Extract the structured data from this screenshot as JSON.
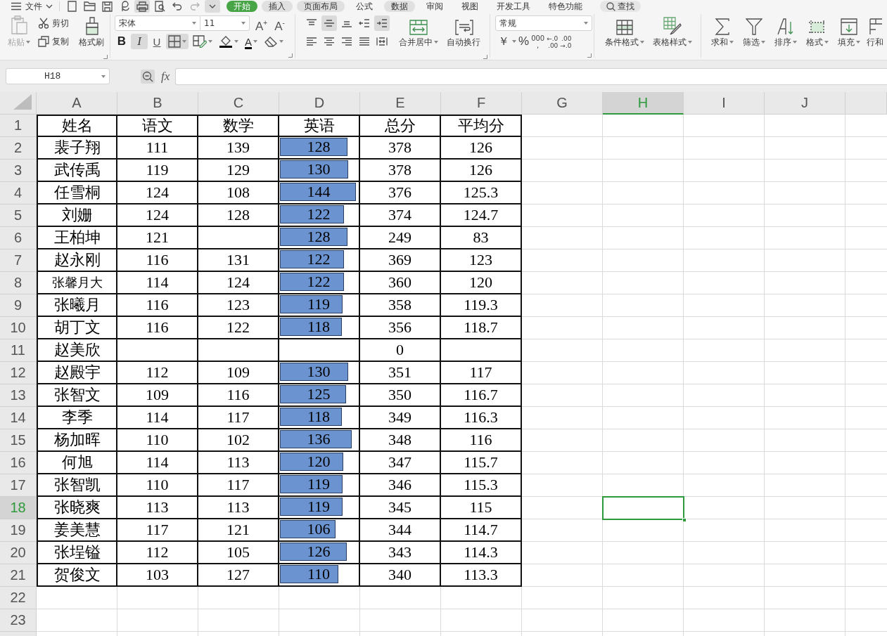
{
  "menu_bar": {
    "file_menu": "文件",
    "quick_access": [
      {
        "kind": "new",
        "shaded": false,
        "disabled": false
      },
      {
        "kind": "open",
        "shaded": false,
        "disabled": false
      },
      {
        "kind": "save",
        "shaded": false,
        "disabled": false
      },
      {
        "kind": "export",
        "shaded": false,
        "disabled": false
      },
      {
        "kind": "print",
        "shaded": true,
        "disabled": false
      },
      {
        "kind": "preview",
        "shaded": false,
        "disabled": false
      },
      {
        "kind": "undo",
        "shaded": false,
        "disabled": false
      },
      {
        "kind": "redo",
        "shaded": false,
        "disabled": true
      },
      {
        "kind": "more",
        "shaded": true,
        "disabled": false
      }
    ],
    "tabs": [
      {
        "label": "开始",
        "selected": true,
        "shaded": false
      },
      {
        "label": "插入",
        "selected": false,
        "shaded": true
      },
      {
        "label": "页面布局",
        "selected": false,
        "shaded": true
      },
      {
        "label": "公式",
        "selected": false,
        "shaded": false
      },
      {
        "label": "数据",
        "selected": false,
        "shaded": true
      },
      {
        "label": "审阅",
        "selected": false,
        "shaded": false
      },
      {
        "label": "视图",
        "selected": false,
        "shaded": false
      },
      {
        "label": "开发工具",
        "selected": false,
        "shaded": false
      },
      {
        "label": "特色功能",
        "selected": false,
        "shaded": false
      }
    ],
    "search": "查找"
  },
  "ribbon": {
    "clipboard": {
      "launcher": true,
      "buttons": [
        {
          "kind": "paste",
          "label": "粘贴",
          "disabled": true,
          "dropdown": true
        },
        {
          "kind": "cut",
          "label": "剪切",
          "disabled": false,
          "dropdown": false
        },
        {
          "kind": "copy",
          "label": "复制",
          "disabled": false,
          "dropdown": false
        },
        {
          "kind": "format-painter",
          "label": "格式刷",
          "disabled": false,
          "dropdown": false
        }
      ]
    },
    "font": {
      "launcher": true,
      "name": "宋体",
      "size": "11",
      "grow": "A$^{+}$",
      "shrink": "A$^{-}$",
      "buttons": [
        {
          "kind": "bold",
          "label": "B",
          "selected": false,
          "dropdown": false
        },
        {
          "kind": "italic",
          "label": "I",
          "selected": true,
          "dropdown": false
        },
        {
          "kind": "underline",
          "label": "U",
          "selected": false,
          "dropdown": false
        },
        {
          "kind": "borders",
          "selected": true,
          "dropdown": true
        },
        {
          "kind": "draw-borders",
          "selected": false,
          "dropdown": true
        },
        {
          "kind": "fill-color",
          "selected": false,
          "dropdown": true
        },
        {
          "kind": "font-color",
          "label": "A",
          "selected": false,
          "dropdown": true
        },
        {
          "kind": "clear",
          "selected": false,
          "dropdown": true
        }
      ]
    },
    "alignment": {
      "launcher": true,
      "buttons": [
        {
          "kind": "top",
          "selected": false
        },
        {
          "kind": "middle",
          "selected": true
        },
        {
          "kind": "bottom",
          "selected": false
        },
        {
          "kind": "indent-decrease",
          "selected": false
        },
        {
          "kind": "indent-increase",
          "selected": true
        },
        {
          "kind": "left",
          "selected": false
        },
        {
          "kind": "center",
          "selected": false
        },
        {
          "kind": "right",
          "selected": false
        },
        {
          "kind": "justify",
          "selected": false
        },
        {
          "kind": "distributed",
          "selected": false
        }
      ],
      "actions": [
        {
          "kind": "merge",
          "label": "合并居中",
          "dropdown": true
        },
        {
          "kind": "wrap",
          "label": "自动换行",
          "dropdown": false
        }
      ]
    },
    "number": {
      "launcher": true,
      "format": "常规",
      "buttons": [
        {
          "kind": "currency",
          "label": "￥",
          "dropdown": true
        },
        {
          "kind": "percent",
          "label": "%",
          "dropdown": false
        },
        {
          "kind": "thousands",
          "label": "000",
          "sublabel": ",",
          "dropdown": false
        },
        {
          "kind": "increase-decimal",
          "label": "←.0",
          "sublabel": ".00",
          "dropdown": false
        },
        {
          "kind": "decrease-decimal",
          "label": ".00",
          "sublabel": "→.0",
          "dropdown": false
        }
      ]
    },
    "styles": {
      "buttons": [
        {
          "kind": "conditional-format",
          "label": "条件格式",
          "dropdown": true
        },
        {
          "kind": "table-style",
          "label": "表格样式",
          "dropdown": true
        }
      ]
    },
    "editing": {
      "buttons": [
        {
          "kind": "sum",
          "label": "求和",
          "dropdown": true
        },
        {
          "kind": "filter",
          "label": "筛选",
          "dropdown": true
        },
        {
          "kind": "sort",
          "label": "排序",
          "dropdown": true
        },
        {
          "kind": "format",
          "label": "格式",
          "dropdown": true
        },
        {
          "kind": "fill",
          "label": "填充",
          "dropdown": true
        },
        {
          "kind": "rows-columns",
          "label": "行和",
          "dropdown": false
        }
      ]
    }
  },
  "formula_bar": {
    "cell_reference": "H18",
    "function_label": "fx"
  },
  "sheet": {
    "columns": [
      {
        "label": "A",
        "selected": false
      },
      {
        "label": "B",
        "selected": false
      },
      {
        "label": "C",
        "selected": false
      },
      {
        "label": "D",
        "selected": false
      },
      {
        "label": "E",
        "selected": false
      },
      {
        "label": "F",
        "selected": false
      },
      {
        "label": "G",
        "selected": false
      },
      {
        "label": "H",
        "selected": true
      },
      {
        "label": "I",
        "selected": false
      },
      {
        "label": "J",
        "selected": false
      }
    ],
    "row_headers": [
      {
        "label": "1",
        "selected": false
      },
      {
        "label": "2",
        "selected": false
      },
      {
        "label": "3",
        "selected": false
      },
      {
        "label": "4",
        "selected": false
      },
      {
        "label": "5",
        "selected": false
      },
      {
        "label": "6",
        "selected": false
      },
      {
        "label": "7",
        "selected": false
      },
      {
        "label": "8",
        "selected": false
      },
      {
        "label": "9",
        "selected": false
      },
      {
        "label": "10",
        "selected": false
      },
      {
        "label": "11",
        "selected": false
      },
      {
        "label": "12",
        "selected": false
      },
      {
        "label": "13",
        "selected": false
      },
      {
        "label": "14",
        "selected": false
      },
      {
        "label": "15",
        "selected": false
      },
      {
        "label": "16",
        "selected": false
      },
      {
        "label": "17",
        "selected": false
      },
      {
        "label": "18",
        "selected": true
      },
      {
        "label": "19",
        "selected": false
      },
      {
        "label": "20",
        "selected": false
      },
      {
        "label": "21",
        "selected": false
      },
      {
        "label": "22",
        "selected": false
      },
      {
        "label": "23",
        "selected": false
      }
    ],
    "table": {
      "header": [
        "姓名",
        "语文",
        "数学",
        "英语",
        "总分",
        "平均分"
      ],
      "rows": [
        {
          "name": "裴子翔",
          "small_name": false,
          "chinese": "111",
          "math": "139",
          "english": {
            "value": "128",
            "level": 0.87
          },
          "total": "378",
          "average": "126"
        },
        {
          "name": "武传禹",
          "small_name": false,
          "chinese": "119",
          "math": "129",
          "english": {
            "value": "130",
            "level": 0.88
          },
          "total": "378",
          "average": "126"
        },
        {
          "name": "任雪桐",
          "small_name": false,
          "chinese": "124",
          "math": "108",
          "english": {
            "value": "144",
            "level": 0.98
          },
          "total": "376",
          "average": "125.3"
        },
        {
          "name": "刘姗",
          "small_name": false,
          "chinese": "124",
          "math": "128",
          "english": {
            "value": "122",
            "level": 0.83
          },
          "total": "374",
          "average": "124.7"
        },
        {
          "name": "王柏坤",
          "small_name": false,
          "chinese": "121",
          "english": {
            "value": "128",
            "level": 0.87
          },
          "total": "249",
          "average": "83"
        },
        {
          "name": "赵永刚",
          "small_name": false,
          "chinese": "116",
          "math": "131",
          "english": {
            "value": "122",
            "level": 0.83
          },
          "total": "369",
          "average": "123"
        },
        {
          "name": "张馨月大",
          "small_name": true,
          "chinese": "114",
          "math": "124",
          "english": {
            "value": "122",
            "level": 0.83
          },
          "total": "360",
          "average": "120"
        },
        {
          "name": "张曦月",
          "small_name": false,
          "chinese": "116",
          "math": "123",
          "english": {
            "value": "119",
            "level": 0.81
          },
          "total": "358",
          "average": "119.3"
        },
        {
          "name": "胡丁文",
          "small_name": false,
          "chinese": "116",
          "math": "122",
          "english": {
            "value": "118",
            "level": 0.8
          },
          "total": "356",
          "average": "118.7"
        },
        {
          "name": "赵美欣",
          "small_name": false,
          "total": "0"
        },
        {
          "name": "赵殿宇",
          "small_name": false,
          "chinese": "112",
          "math": "109",
          "english": {
            "value": "130",
            "level": 0.88
          },
          "total": "351",
          "average": "117"
        },
        {
          "name": "张智文",
          "small_name": false,
          "chinese": "109",
          "math": "116",
          "english": {
            "value": "125",
            "level": 0.85
          },
          "total": "350",
          "average": "116.7"
        },
        {
          "name": "李季",
          "small_name": false,
          "chinese": "114",
          "math": "117",
          "english": {
            "value": "118",
            "level": 0.8
          },
          "total": "349",
          "average": "116.3"
        },
        {
          "name": "杨加晖",
          "small_name": false,
          "chinese": "110",
          "math": "102",
          "english": {
            "value": "136",
            "level": 0.93
          },
          "total": "348",
          "average": "116"
        },
        {
          "name": "何旭",
          "small_name": false,
          "chinese": "114",
          "math": "113",
          "english": {
            "value": "120",
            "level": 0.82
          },
          "total": "347",
          "average": "115.7"
        },
        {
          "name": "张智凯",
          "small_name": false,
          "chinese": "110",
          "math": "117",
          "english": {
            "value": "119",
            "level": 0.81
          },
          "total": "346",
          "average": "115.3"
        },
        {
          "name": "张晓爽",
          "small_name": false,
          "chinese": "113",
          "math": "113",
          "english": {
            "value": "119",
            "level": 0.81
          },
          "total": "345",
          "average": "115"
        },
        {
          "name": "姜美慧",
          "small_name": false,
          "chinese": "117",
          "math": "121",
          "english": {
            "value": "106",
            "level": 0.72
          },
          "total": "344",
          "average": "114.7"
        },
        {
          "name": "张埕镒",
          "small_name": false,
          "chinese": "112",
          "math": "105",
          "english": {
            "value": "126",
            "level": 0.86
          },
          "total": "343",
          "average": "114.3"
        },
        {
          "name": "贺俊文",
          "small_name": false,
          "chinese": "103",
          "math": "127",
          "english": {
            "value": "110",
            "level": 0.75
          },
          "total": "340",
          "average": "113.3"
        }
      ]
    }
  }
}
